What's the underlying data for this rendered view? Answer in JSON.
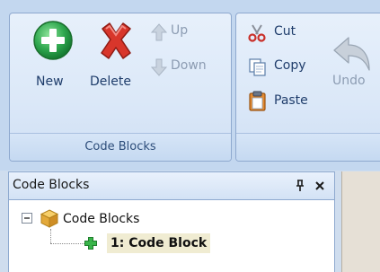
{
  "ribbon": {
    "code_blocks_group": {
      "label": "Code Blocks",
      "new_label": "New",
      "delete_label": "Delete",
      "up_label": "Up",
      "down_label": "Down"
    },
    "clipboard_group": {
      "cut_label": "Cut",
      "copy_label": "Copy",
      "paste_label": "Paste",
      "undo_label": "Undo"
    }
  },
  "panel": {
    "title": "Code Blocks",
    "pin_glyph": "p",
    "close_glyph": "×",
    "tree": {
      "root_label": "Code Blocks",
      "child_label": "1: Code Block"
    }
  },
  "colors": {
    "ribbon_bg": "#c3d7ef",
    "new_icon": "#2fa84f",
    "delete_icon": "#d8362b",
    "text": "#1f3d6b"
  }
}
